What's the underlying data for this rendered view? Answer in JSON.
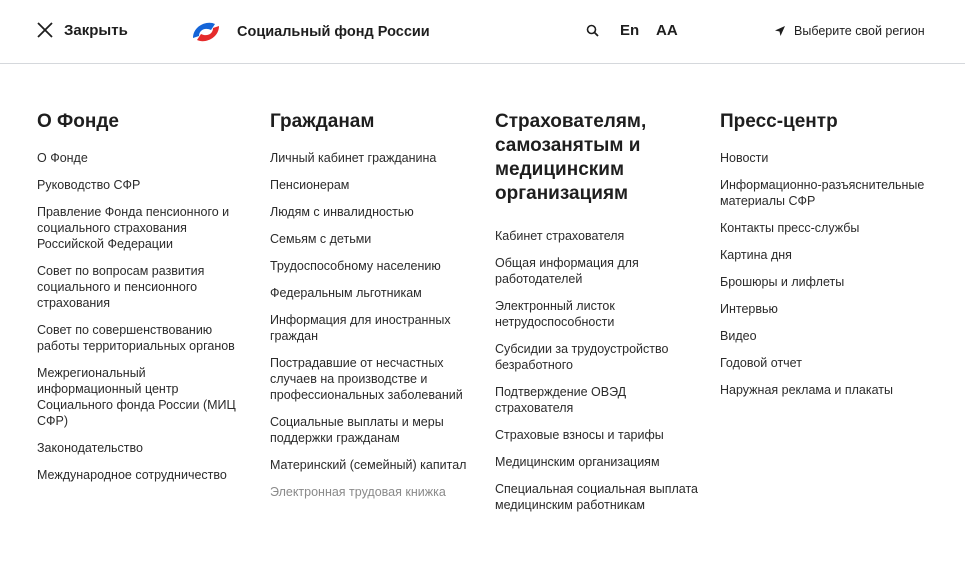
{
  "header": {
    "close_label": "Закрыть",
    "brand_name": "Социальный фонд России",
    "lang_label": "En",
    "a11y_label": "AA",
    "region_label": "Выберите свой регион"
  },
  "columns": [
    {
      "title": "О Фонде",
      "items": [
        "О Фонде",
        "Руководство СФР",
        "Правление Фонда пенсионного и социального страхования Российской Федерации",
        "Совет по вопросам развития социального и пенсионного страхования",
        "Совет по совершенствованию работы территориальных органов",
        "Межрегиональный информационный центр Социального фонда России (МИЦ СФР)",
        "Законодательство",
        "Международное сотрудничество"
      ]
    },
    {
      "title": "Гражданам",
      "items": [
        "Личный кабинет гражданина",
        "Пенсионерам",
        "Людям с инвалидностью",
        "Семьям с детьми",
        "Трудоспособному населению",
        "Федеральным льготникам",
        "Информация для иностранных граждан",
        "Пострадавшие от несчастных случаев на производстве и профессиональных заболеваний",
        "Социальные выплаты и меры поддержки гражданам",
        "Материнский (семейный) капитал",
        "Электронная трудовая книжка"
      ]
    },
    {
      "title": "Страхователям, самозанятым и медицинским организациям",
      "items": [
        "Кабинет страхователя",
        "Общая информация для работодателей",
        "Электронный листок нетрудоспособности",
        "Субсидии за трудоустройство безработного",
        "Подтверждение ОВЭД страхователя",
        "Страховые взносы и тарифы",
        "Медицинским организациям",
        "Специальная социальная выплата медицинским работникам"
      ]
    },
    {
      "title": "Пресс-центр",
      "items": [
        "Новости",
        "Информационно-разъяснительные материалы СФР",
        "Контакты пресс-службы",
        "Картина дня",
        "Брошюры и лифлеты",
        "Интервью",
        "Видео",
        "Годовой отчет",
        "Наружная реклама и плакаты"
      ]
    }
  ],
  "colors": {
    "logo_blue": "#1565d8",
    "logo_red": "#e52b2b",
    "text": "#1e1e1e",
    "divider": "#d5d8dc"
  },
  "icons": [
    "close-icon",
    "logo-icon",
    "search-icon",
    "location-arrow-icon"
  ]
}
